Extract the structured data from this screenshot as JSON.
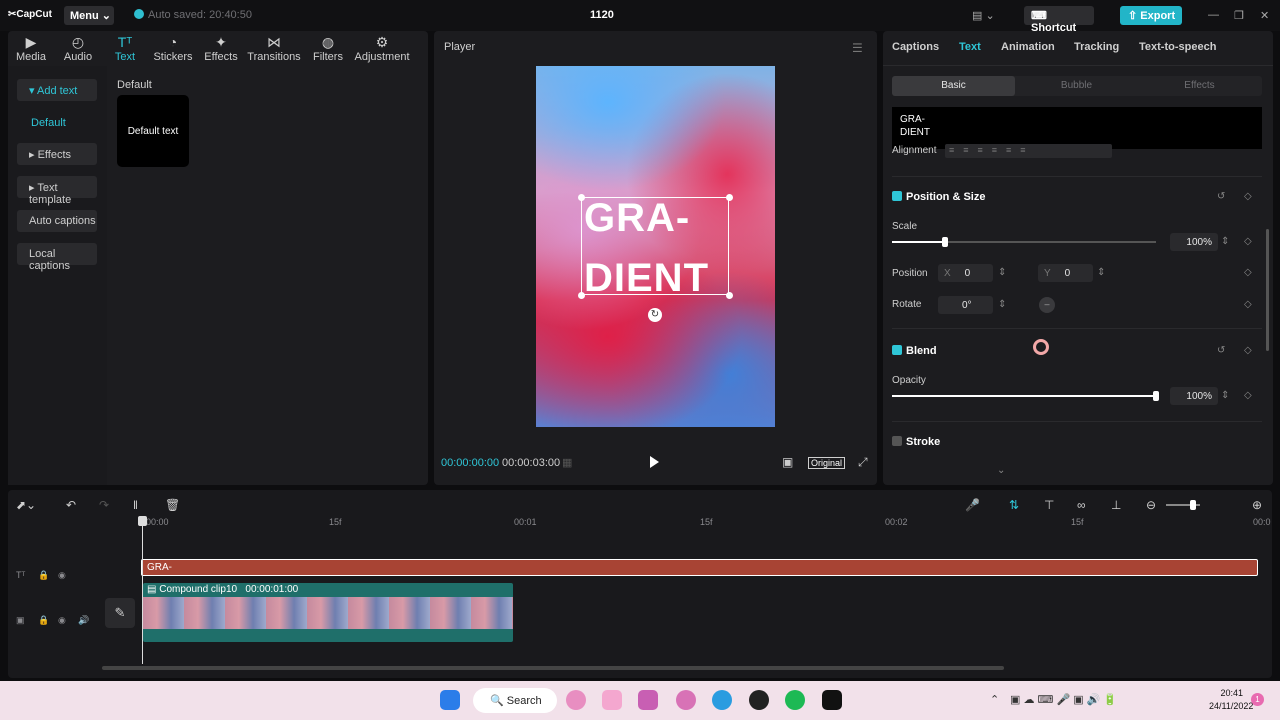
{
  "app": {
    "logo": "CapCut",
    "menu_label": "Menu",
    "autosave": "Auto saved: 20:40:50",
    "project_title": "1120",
    "shortcut_label": "Shortcut",
    "export_label": "Export",
    "accent_color": "#2fc6d7"
  },
  "toolbar": {
    "items": [
      {
        "label": "Media",
        "icon": "media-icon"
      },
      {
        "label": "Audio",
        "icon": "audio-icon"
      },
      {
        "label": "Text",
        "icon": "text-icon",
        "active": true
      },
      {
        "label": "Stickers",
        "icon": "stickers-icon"
      },
      {
        "label": "Effects",
        "icon": "effects-icon"
      },
      {
        "label": "Transitions",
        "icon": "transitions-icon"
      },
      {
        "label": "Filters",
        "icon": "filters-icon"
      },
      {
        "label": "Adjustment",
        "icon": "adjustment-icon"
      }
    ]
  },
  "subnav": {
    "items": [
      {
        "label": "Add text",
        "active": true
      },
      {
        "label": "Default"
      },
      {
        "label": "Effects"
      },
      {
        "label": "Text template"
      },
      {
        "label": "Auto captions"
      },
      {
        "label": "Local captions"
      }
    ]
  },
  "library": {
    "category": "Default",
    "card_label": "Default text"
  },
  "player": {
    "title": "Player",
    "text_line1": "GRA-",
    "text_line2": "DIENT",
    "current_time": "00:00:00:00",
    "duration": "00:00:03:00",
    "ratio_label": "Original"
  },
  "inspector": {
    "tabs": [
      "Captions",
      "Text",
      "Animation",
      "Tracking",
      "Text-to-speech"
    ],
    "active_tab": "Text",
    "segments": [
      "Basic",
      "Bubble",
      "Effects"
    ],
    "text_value_line1": "GRA-",
    "text_value_line2": "DIENT",
    "alignment_label": "Alignment",
    "position_size": {
      "title": "Position & Size",
      "scale_label": "Scale",
      "scale_value": "100%",
      "scale_fraction": 0.2,
      "position_label": "Position",
      "x_label": "X",
      "x_value": "0",
      "y_label": "Y",
      "y_value": "0",
      "rotate_label": "Rotate",
      "rotate_value": "0°"
    },
    "blend": {
      "title": "Blend",
      "opacity_label": "Opacity",
      "opacity_value": "100%",
      "opacity_fraction": 1.0
    },
    "stroke": {
      "title": "Stroke"
    }
  },
  "timeline": {
    "ticks": [
      "00:00",
      "15f",
      "00:01",
      "15f",
      "00:02",
      "15f",
      "00:0"
    ],
    "text_clip_label": "GRA-",
    "compound_label": "Compound clip10",
    "compound_duration": "00:00:01:00"
  },
  "taskbar": {
    "search_label": "Search",
    "time": "20:41",
    "date": "24/11/2022"
  }
}
